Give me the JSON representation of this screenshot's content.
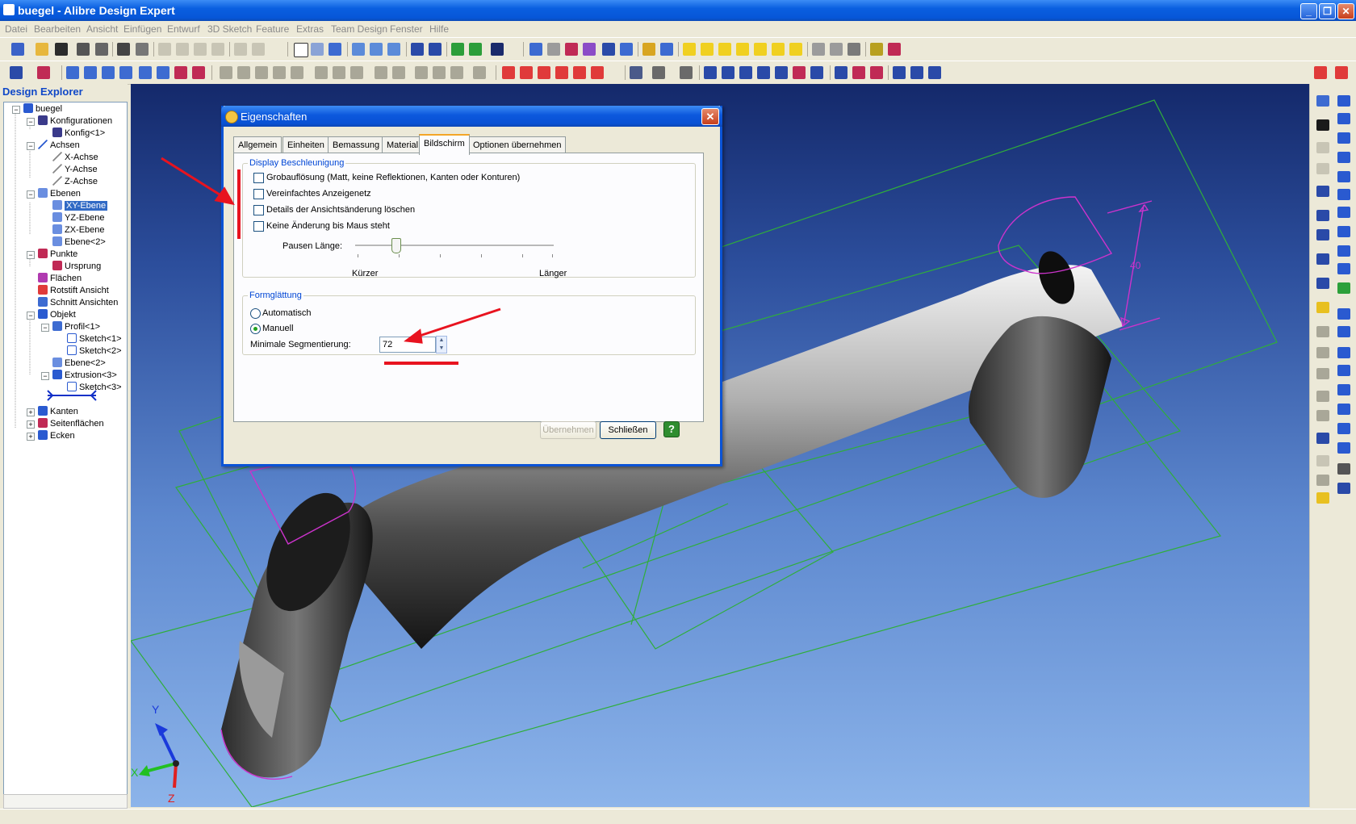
{
  "window": {
    "title": "buegel - Alibre Design Expert"
  },
  "menu": [
    "Datei",
    "Bearbeiten",
    "Ansicht",
    "Einfügen",
    "Entwurf",
    "3D Sketch",
    "Feature",
    "Extras",
    "Team Design",
    "Fenster",
    "Hilfe"
  ],
  "explorer": {
    "header": "Design Explorer",
    "nodes": [
      {
        "label": "buegel",
        "icon": "part-icon"
      },
      {
        "label": "Konfigurationen",
        "icon": "table-icon"
      },
      {
        "label": "Konfig<1>",
        "icon": "table-icon"
      },
      {
        "label": "Achsen",
        "icon": "axis-icon"
      },
      {
        "label": "X-Achse",
        "icon": "axis-icon"
      },
      {
        "label": "Y-Achse",
        "icon": "axis-icon"
      },
      {
        "label": "Z-Achse",
        "icon": "axis-icon"
      },
      {
        "label": "Ebenen",
        "icon": "plane-icon"
      },
      {
        "label": "XY-Ebene",
        "icon": "plane-icon"
      },
      {
        "label": "YZ-Ebene",
        "icon": "plane-icon"
      },
      {
        "label": "ZX-Ebene",
        "icon": "plane-icon"
      },
      {
        "label": "Ebene<2>",
        "icon": "plane-icon"
      },
      {
        "label": "Punkte",
        "icon": "point-icon"
      },
      {
        "label": "Ursprung",
        "icon": "point-icon"
      },
      {
        "label": "Flächen",
        "icon": "surface-icon"
      },
      {
        "label": "Rotstift Ansicht",
        "icon": "redline-icon"
      },
      {
        "label": "Schnitt Ansichten",
        "icon": "section-icon"
      },
      {
        "label": "Objekt",
        "icon": "body-icon"
      },
      {
        "label": "Profil<1>",
        "icon": "profile-icon"
      },
      {
        "label": "Sketch<1>",
        "icon": "sketch-icon"
      },
      {
        "label": "Sketch<2>",
        "icon": "sketch-icon"
      },
      {
        "label": "Ebene<2>",
        "icon": "plane-icon"
      },
      {
        "label": "Extrusion<3>",
        "icon": "extrusion-icon"
      },
      {
        "label": "Sketch<3>",
        "icon": "sketch-icon"
      },
      {
        "label": "Kanten",
        "icon": "edges-icon"
      },
      {
        "label": "Seitenflächen",
        "icon": "faces-icon"
      },
      {
        "label": "Ecken",
        "icon": "vertices-icon"
      }
    ]
  },
  "dialog": {
    "title": "Eigenschaften",
    "tabs": [
      "Allgemein",
      "Einheiten",
      "Bemassung",
      "Material",
      "Bildschirm",
      "Optionen übernehmen"
    ],
    "active_tab": "Bildschirm",
    "display_group": {
      "legend": "Display Beschleunigung",
      "checkboxes": [
        {
          "label": "Grobauflösung (Matt, keine Reflektionen, Kanten oder Konturen)",
          "checked": false
        },
        {
          "label": "Vereinfachtes Anzeigenetz",
          "checked": false
        },
        {
          "label": "Details der Ansichtsänderung löschen",
          "checked": false
        },
        {
          "label": "Keine Änderung bis Maus steht",
          "checked": false
        }
      ],
      "slider_label": "Pausen Länge:",
      "slider_min_label": "Kürzer",
      "slider_max_label": "Länger",
      "slider_value_fraction": 0.2
    },
    "smoothing_group": {
      "legend": "Formglättung",
      "options": [
        {
          "label": "Automatisch",
          "selected": false
        },
        {
          "label": "Manuell",
          "selected": true
        }
      ],
      "segment_label": "Minimale Segmentierung:",
      "segment_value": "72"
    },
    "buttons": {
      "apply": "Übernehmen",
      "close": "Schließen",
      "help": "?"
    }
  },
  "viewport": {
    "dimension_label": "40",
    "triad": {
      "x": "X",
      "y": "Y",
      "z": "Z"
    },
    "colors": {
      "sketch": "#cc33cc",
      "plane": "#2fae3a",
      "annotation": "#e8131f"
    }
  }
}
